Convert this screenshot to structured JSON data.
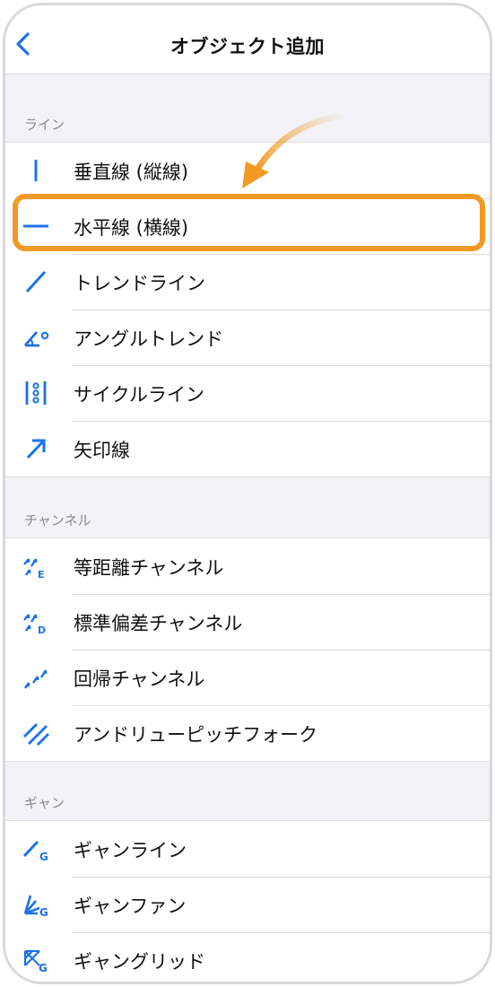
{
  "navbar": {
    "title": "オブジェクト追加",
    "back_icon": "chevron-left-icon"
  },
  "sections": [
    {
      "header": "ライン",
      "items": [
        {
          "label": "垂直線 (縦線)",
          "icon": "vertical-line-icon"
        },
        {
          "label": "水平線 (横線)",
          "icon": "horizontal-line-icon",
          "highlighted": true
        },
        {
          "label": "トレンドライン",
          "icon": "trendline-icon"
        },
        {
          "label": "アングルトレンド",
          "icon": "angle-trend-icon"
        },
        {
          "label": "サイクルライン",
          "icon": "cycle-line-icon"
        },
        {
          "label": "矢印線",
          "icon": "arrow-line-icon"
        }
      ]
    },
    {
      "header": "チャンネル",
      "items": [
        {
          "label": "等距離チャンネル",
          "icon": "equidistant-channel-icon"
        },
        {
          "label": "標準偏差チャンネル",
          "icon": "std-deviation-channel-icon"
        },
        {
          "label": "回帰チャンネル",
          "icon": "regression-channel-icon"
        },
        {
          "label": "アンドリューピッチフォーク",
          "icon": "pitchfork-icon"
        }
      ]
    },
    {
      "header": "ギャン",
      "items": [
        {
          "label": "ギャンライン",
          "icon": "gann-line-icon"
        },
        {
          "label": "ギャンファン",
          "icon": "gann-fan-icon"
        },
        {
          "label": "ギャングリッド",
          "icon": "gann-grid-icon"
        }
      ]
    }
  ],
  "colors": {
    "accent": "#1a73e8",
    "highlight": "#f29a24",
    "separator": "#dcdcdc",
    "background": "#f2f2f7"
  }
}
